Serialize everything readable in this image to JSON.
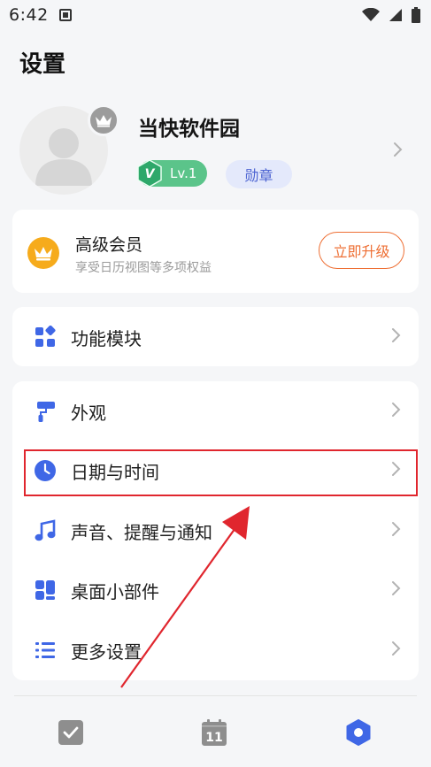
{
  "status_bar": {
    "time": "6:42"
  },
  "page": {
    "title": "设置"
  },
  "profile": {
    "username": "当快软件园",
    "level": "Lv.1",
    "level_prefix": "V",
    "medal": "勋章"
  },
  "vip": {
    "title": "高级会员",
    "subtitle": "享受日历视图等多项权益",
    "button": "立即升级"
  },
  "rows": {
    "modules": "功能模块",
    "appearance": "外观",
    "datetime": "日期与时间",
    "sound": "声音、提醒与通知",
    "widgets": "桌面小部件",
    "more": "更多设置"
  },
  "bottom_nav": {
    "calendar_day": "11",
    "items": [
      "task-check-icon",
      "calendar-icon",
      "settings-hex-icon"
    ],
    "active": "settings-hex-icon"
  },
  "colors": {
    "accent_blue": "#3f67e6",
    "vip_gold": "#f6ab1c",
    "upgrade_orange": "#ee6f34",
    "level_green": "#5bc48a",
    "highlight_red": "#e0262e"
  }
}
